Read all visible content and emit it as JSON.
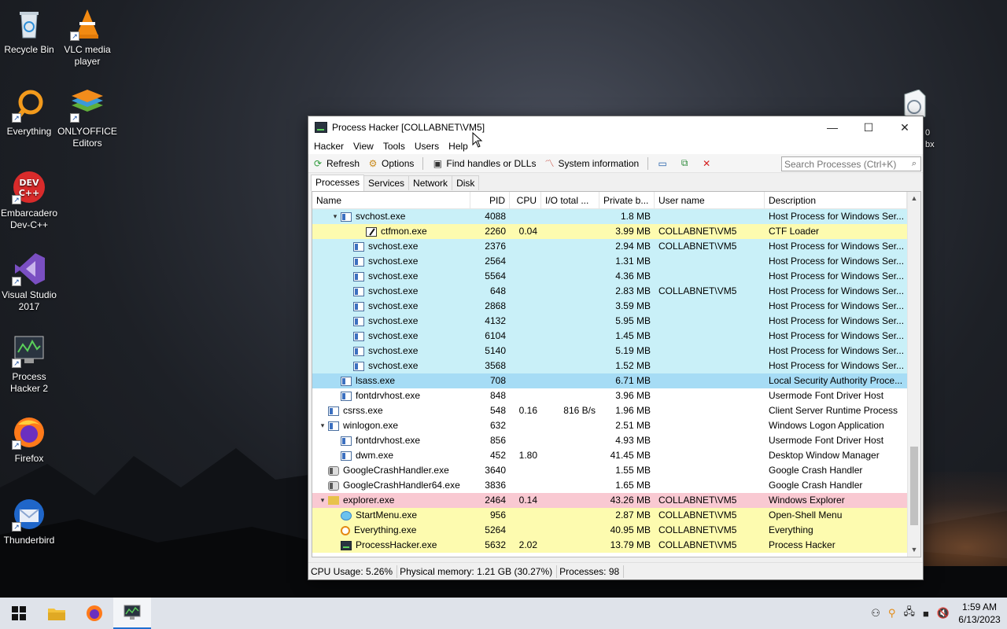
{
  "desktop": {
    "icons": [
      {
        "label": "Recycle Bin",
        "icon": "recycle-bin-icon"
      },
      {
        "label": "VLC media player",
        "icon": "vlc-icon"
      },
      {
        "label": "Everything",
        "icon": "everything-search-icon"
      },
      {
        "label": "ONLYOFFICE Editors",
        "icon": "onlyoffice-icon"
      },
      {
        "label": "Embarcadero Dev-C++",
        "icon": "devcpp-icon"
      },
      {
        "label": "Visual Studio 2017",
        "icon": "visual-studio-icon"
      },
      {
        "label": "Process Hacker 2",
        "icon": "process-hacker-icon"
      },
      {
        "label": "Firefox",
        "icon": "firefox-icon"
      },
      {
        "label": "Thunderbird",
        "icon": "thunderbird-icon"
      }
    ],
    "partial_icon_text": "0\nbx"
  },
  "window": {
    "title": "Process Hacker [COLLABNET\\VM5]",
    "controls": {
      "minimize": "—",
      "maximize": "☐",
      "close": "✕"
    },
    "menu": [
      "Hacker",
      "View",
      "Tools",
      "Users",
      "Help"
    ],
    "toolbar": {
      "refresh": "Refresh",
      "options": "Options",
      "find_handles": "Find handles or DLLs",
      "system_info": "System information"
    },
    "search": {
      "placeholder": "Search Processes (Ctrl+K)"
    },
    "tabs": [
      "Processes",
      "Services",
      "Network",
      "Disk"
    ],
    "columns": [
      "Name",
      "PID",
      "CPU",
      "I/O total ...",
      "Private b...",
      "User name",
      "Description"
    ],
    "rows": [
      {
        "indent": 2,
        "arrow": "▾",
        "icon": "svc",
        "name": "svchost.exe",
        "pid": "4088",
        "cpu": "",
        "io": "",
        "pb": "1.8 MB",
        "user": "",
        "desc": "Host Process for Windows Ser...",
        "bg": "#c9f0f8"
      },
      {
        "indent": 4,
        "arrow": "",
        "icon": "pen",
        "name": "ctfmon.exe",
        "pid": "2260",
        "cpu": "0.04",
        "io": "",
        "pb": "3.99 MB",
        "user": "COLLABNET\\VM5",
        "desc": "CTF Loader",
        "bg": "#fdfbaf"
      },
      {
        "indent": 3,
        "arrow": "",
        "icon": "svc",
        "name": "svchost.exe",
        "pid": "2376",
        "cpu": "",
        "io": "",
        "pb": "2.94 MB",
        "user": "COLLABNET\\VM5",
        "desc": "Host Process for Windows Ser...",
        "bg": "#c9f0f8"
      },
      {
        "indent": 3,
        "arrow": "",
        "icon": "svc",
        "name": "svchost.exe",
        "pid": "2564",
        "cpu": "",
        "io": "",
        "pb": "1.31 MB",
        "user": "",
        "desc": "Host Process for Windows Ser...",
        "bg": "#c9f0f8"
      },
      {
        "indent": 3,
        "arrow": "",
        "icon": "svc",
        "name": "svchost.exe",
        "pid": "5564",
        "cpu": "",
        "io": "",
        "pb": "4.36 MB",
        "user": "",
        "desc": "Host Process for Windows Ser...",
        "bg": "#c9f0f8"
      },
      {
        "indent": 3,
        "arrow": "",
        "icon": "svc",
        "name": "svchost.exe",
        "pid": "648",
        "cpu": "",
        "io": "",
        "pb": "2.83 MB",
        "user": "COLLABNET\\VM5",
        "desc": "Host Process for Windows Ser...",
        "bg": "#c9f0f8"
      },
      {
        "indent": 3,
        "arrow": "",
        "icon": "svc",
        "name": "svchost.exe",
        "pid": "2868",
        "cpu": "",
        "io": "",
        "pb": "3.59 MB",
        "user": "",
        "desc": "Host Process for Windows Ser...",
        "bg": "#c9f0f8"
      },
      {
        "indent": 3,
        "arrow": "",
        "icon": "svc",
        "name": "svchost.exe",
        "pid": "4132",
        "cpu": "",
        "io": "",
        "pb": "5.95 MB",
        "user": "",
        "desc": "Host Process for Windows Ser...",
        "bg": "#c9f0f8"
      },
      {
        "indent": 3,
        "arrow": "",
        "icon": "svc",
        "name": "svchost.exe",
        "pid": "6104",
        "cpu": "",
        "io": "",
        "pb": "1.45 MB",
        "user": "",
        "desc": "Host Process for Windows Ser...",
        "bg": "#c9f0f8"
      },
      {
        "indent": 3,
        "arrow": "",
        "icon": "svc",
        "name": "svchost.exe",
        "pid": "5140",
        "cpu": "",
        "io": "",
        "pb": "5.19 MB",
        "user": "",
        "desc": "Host Process for Windows Ser...",
        "bg": "#c9f0f8"
      },
      {
        "indent": 3,
        "arrow": "",
        "icon": "svc",
        "name": "svchost.exe",
        "pid": "3568",
        "cpu": "",
        "io": "",
        "pb": "1.52 MB",
        "user": "",
        "desc": "Host Process for Windows Ser...",
        "bg": "#c9f0f8"
      },
      {
        "indent": 2,
        "arrow": "",
        "icon": "svc",
        "name": "lsass.exe",
        "pid": "708",
        "cpu": "",
        "io": "",
        "pb": "6.71 MB",
        "user": "",
        "desc": "Local Security Authority Proce...",
        "bg": "#a6dcf5"
      },
      {
        "indent": 2,
        "arrow": "",
        "icon": "svc",
        "name": "fontdrvhost.exe",
        "pid": "848",
        "cpu": "",
        "io": "",
        "pb": "3.96 MB",
        "user": "",
        "desc": "Usermode Font Driver Host",
        "bg": "#ffffff"
      },
      {
        "indent": 1,
        "arrow": "",
        "icon": "svc",
        "name": "csrss.exe",
        "pid": "548",
        "cpu": "0.16",
        "io": "816 B/s",
        "pb": "1.96 MB",
        "user": "",
        "desc": "Client Server Runtime Process",
        "bg": "#ffffff"
      },
      {
        "indent": 1,
        "arrow": "▾",
        "icon": "svc",
        "name": "winlogon.exe",
        "pid": "632",
        "cpu": "",
        "io": "",
        "pb": "2.51 MB",
        "user": "",
        "desc": "Windows Logon Application",
        "bg": "#ffffff"
      },
      {
        "indent": 2,
        "arrow": "",
        "icon": "svc",
        "name": "fontdrvhost.exe",
        "pid": "856",
        "cpu": "",
        "io": "",
        "pb": "4.93 MB",
        "user": "",
        "desc": "Usermode Font Driver Host",
        "bg": "#ffffff"
      },
      {
        "indent": 2,
        "arrow": "",
        "icon": "svc",
        "name": "dwm.exe",
        "pid": "452",
        "cpu": "1.80",
        "io": "",
        "pb": "41.45 MB",
        "user": "",
        "desc": "Desktop Window Manager",
        "bg": "#ffffff"
      },
      {
        "indent": 1,
        "arrow": "",
        "icon": "crash",
        "name": "GoogleCrashHandler.exe",
        "pid": "3640",
        "cpu": "",
        "io": "",
        "pb": "1.55 MB",
        "user": "",
        "desc": "Google Crash Handler",
        "bg": "#ffffff"
      },
      {
        "indent": 1,
        "arrow": "",
        "icon": "crash",
        "name": "GoogleCrashHandler64.exe",
        "pid": "3836",
        "cpu": "",
        "io": "",
        "pb": "1.65 MB",
        "user": "",
        "desc": "Google Crash Handler",
        "bg": "#ffffff"
      },
      {
        "indent": 1,
        "arrow": "▾",
        "icon": "folder",
        "name": "explorer.exe",
        "pid": "2464",
        "cpu": "0.14",
        "io": "",
        "pb": "43.26 MB",
        "user": "COLLABNET\\VM5",
        "desc": "Windows Explorer",
        "bg": "#f9c9d2"
      },
      {
        "indent": 2,
        "arrow": "",
        "icon": "globe",
        "name": "StartMenu.exe",
        "pid": "956",
        "cpu": "",
        "io": "",
        "pb": "2.87 MB",
        "user": "COLLABNET\\VM5",
        "desc": "Open-Shell Menu",
        "bg": "#fdfbaf"
      },
      {
        "indent": 2,
        "arrow": "",
        "icon": "mag",
        "name": "Everything.exe",
        "pid": "5264",
        "cpu": "",
        "io": "",
        "pb": "40.95 MB",
        "user": "COLLABNET\\VM5",
        "desc": "Everything",
        "bg": "#fdfbaf"
      },
      {
        "indent": 2,
        "arrow": "",
        "icon": "ph",
        "name": "ProcessHacker.exe",
        "pid": "5632",
        "cpu": "2.02",
        "io": "",
        "pb": "13.79 MB",
        "user": "COLLABNET\\VM5",
        "desc": "Process Hacker",
        "bg": "#fdfbaf"
      }
    ],
    "status": {
      "cpu": "CPU Usage: 5.26%",
      "memory": "Physical memory: 1.21 GB (30.27%)",
      "processes": "Processes: 98"
    }
  },
  "taskbar": {
    "clock_time": "1:59 AM",
    "clock_date": "6/13/2023"
  }
}
